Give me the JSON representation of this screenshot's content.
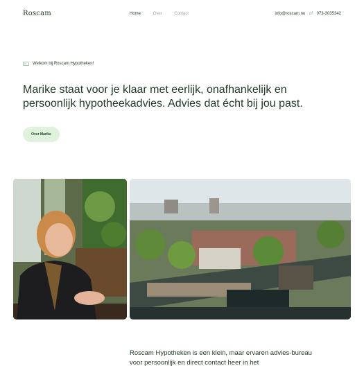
{
  "nav": {
    "logo": "Roscam",
    "links": [
      "Home",
      "Over",
      "Contact"
    ],
    "email": "info@roscam.nu",
    "separator": "of",
    "phone": "073-3035342"
  },
  "hero": {
    "welcome": "Welkom bij Roscam Hypotheken!",
    "headline": "Marike staat voor je klaar met eerlijk, onafhankelijk en persoonlijk hypotheekadvies. Advies dat écht bij jou past.",
    "cta": "Over Marike"
  },
  "intro": {
    "text": "Roscam Hypotheken is een klein, maar ervaren advies-bureau voor persoonlijk en direct contact heer in het"
  }
}
